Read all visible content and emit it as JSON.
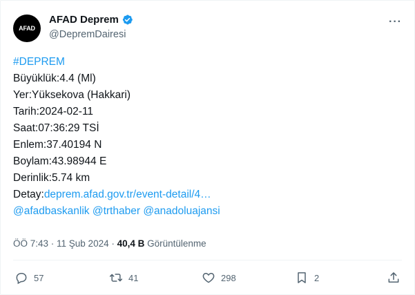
{
  "account": {
    "avatar_text": "AFAD",
    "display_name": "AFAD Deprem",
    "handle": "@DepremDairesi",
    "verified": true
  },
  "more_label": "···",
  "tweet": {
    "hashtag": "#DEPREM",
    "lines": [
      "Büyüklük:4.4 (Ml)",
      "Yer:Yüksekova (Hakkari)",
      "Tarih:2024-02-11",
      "Saat:07:36:29 TSİ",
      "Enlem:37.40194 N",
      "Boylam:43.98944 E",
      "Derinlik:5.74 km"
    ],
    "detail_prefix": "Detay:",
    "detail_link": "deprem.afad.gov.tr/event-detail/4…",
    "mentions": [
      "@afadbaskanlik",
      "@trthaber",
      "@anadoluajansi"
    ]
  },
  "meta": {
    "time_date": "ÖÖ 7:43 · 11 Şub 2024 · ",
    "views_count": "40,4 B",
    "views_label": " Görüntülenme"
  },
  "actions": {
    "reply_count": "57",
    "retweet_count": "41",
    "like_count": "298",
    "bookmark_count": "2"
  },
  "colors": {
    "accent": "#1d9bf0",
    "secondary_text": "#536471",
    "primary_text": "#0f1419"
  }
}
